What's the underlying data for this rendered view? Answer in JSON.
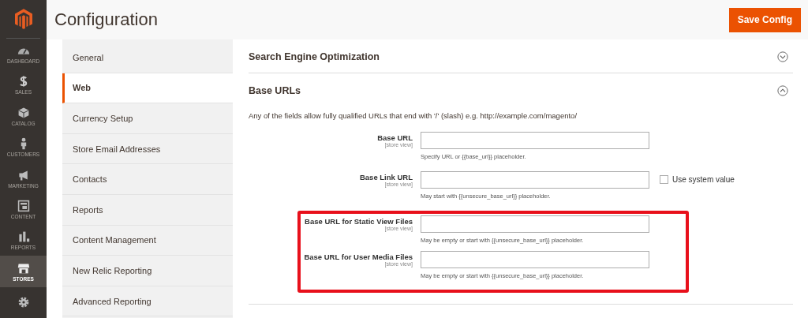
{
  "nav": [
    {
      "label": "DASHBOARD",
      "selected": false
    },
    {
      "label": "SALES",
      "selected": false
    },
    {
      "label": "CATALOG",
      "selected": false
    },
    {
      "label": "CUSTOMERS",
      "selected": false
    },
    {
      "label": "MARKETING",
      "selected": false
    },
    {
      "label": "CONTENT",
      "selected": false
    },
    {
      "label": "REPORTS",
      "selected": false
    },
    {
      "label": "STORES",
      "selected": true
    },
    {
      "selected": false
    }
  ],
  "page_title": "Configuration",
  "save_button": "Save Config",
  "tabs": [
    {
      "label": "General",
      "selected": false
    },
    {
      "label": "Web",
      "selected": true
    },
    {
      "label": "Currency Setup",
      "selected": false
    },
    {
      "label": "Store Email Addresses",
      "selected": false
    },
    {
      "label": "Contacts",
      "selected": false
    },
    {
      "label": "Reports",
      "selected": false
    },
    {
      "label": "Content Management",
      "selected": false
    },
    {
      "label": "New Relic Reporting",
      "selected": false
    },
    {
      "label": "Advanced Reporting",
      "selected": false
    }
  ],
  "sections": [
    {
      "title": "Search Engine Optimization",
      "expanded": false
    },
    {
      "title": "Base URLs",
      "expanded": true,
      "description": "Any of the fields allow fully qualified URLs that end with '/' (slash) e.g. http://example.com/magento/",
      "field_groups": [
        {
          "highlighted": false,
          "fields": [
            {
              "label": "Base URL",
              "scope": "[store view]",
              "note": "Specify URL or {{base_url}} placeholder."
            },
            {
              "label": "Base Link URL",
              "scope": "[store view]",
              "note": "May start with {{unsecure_base_url}} placeholder.",
              "use_system_value": {
                "label": "Use system value",
                "checked": false
              }
            }
          ]
        },
        {
          "highlighted": true,
          "fields": [
            {
              "label": "Base URL for Static View Files",
              "scope": "[store view]",
              "note": "May be empty or start with {{unsecure_base_url}} placeholder."
            },
            {
              "label": "Base URL for User Media Files",
              "scope": "[store view]",
              "note": "May be empty or start with {{unsecure_base_url}} placeholder."
            }
          ]
        }
      ]
    }
  ]
}
